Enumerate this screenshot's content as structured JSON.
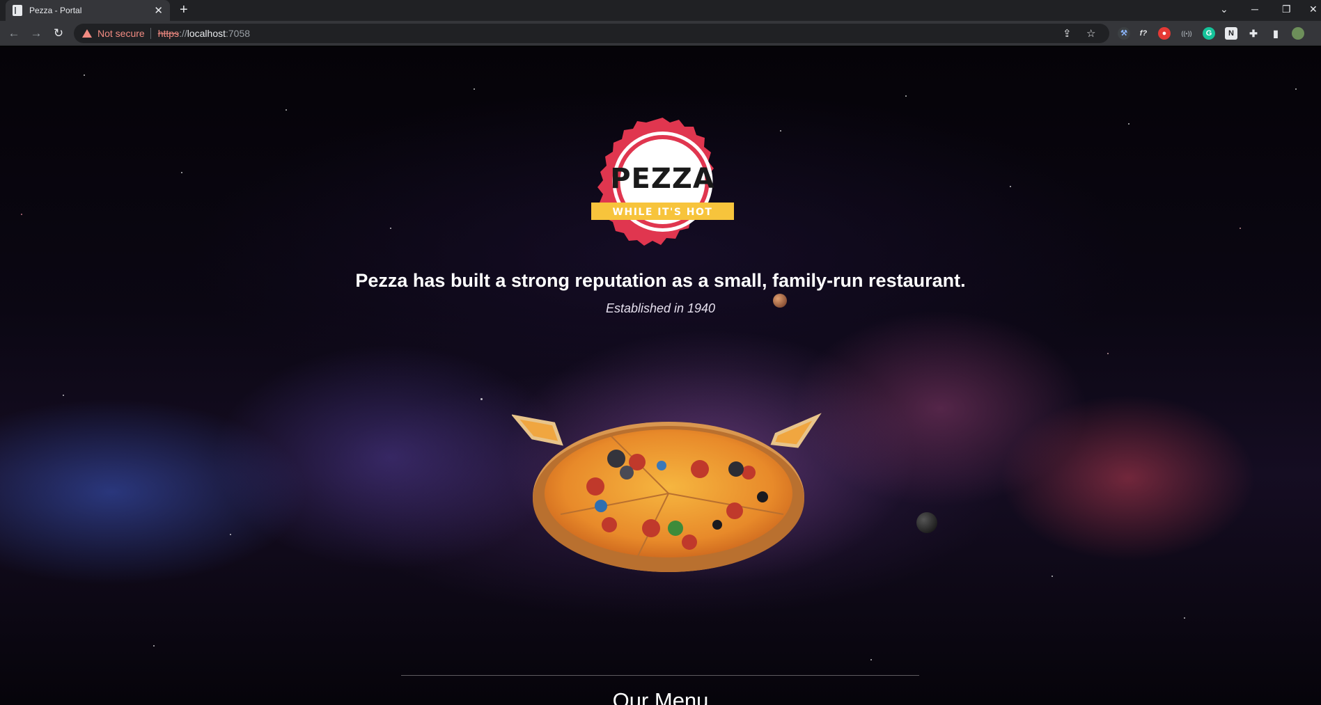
{
  "browser": {
    "tab_title": "Pezza - Portal",
    "tab_close": "✕",
    "new_tab": "+",
    "security_warning": "Not secure",
    "url_scheme": "https",
    "url_separator": "://",
    "url_host": "localhost",
    "url_port": ":7058",
    "window_controls": [
      "⌄",
      "─",
      "❐",
      "✕"
    ]
  },
  "hero": {
    "logo_text": "PEZZA",
    "logo_tagline": "WHILE IT'S HOT",
    "headline": "Pezza has built a strong reputation as a small, family-run restaurant.",
    "established": "Established in 1940"
  },
  "menu_section": {
    "heading": "Our Menu"
  },
  "colors": {
    "brand_red": "#e0364f",
    "brand_yellow": "#f7c43c",
    "chrome_dark": "#202124",
    "chrome_tab": "#35363a",
    "warning": "#f28b82"
  }
}
